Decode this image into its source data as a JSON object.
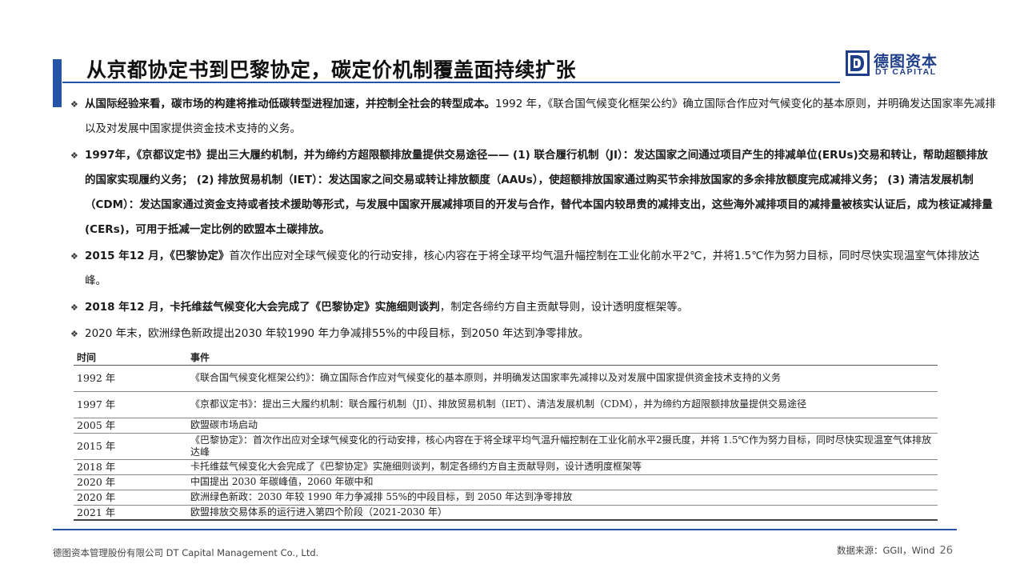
{
  "header": {
    "title": "从京都协定书到巴黎协定，碳定价机制覆盖面持续扩张"
  },
  "logo": {
    "cn": "德图资本",
    "en": "DT CAPITAL",
    "brand_color": "#1f3f8a",
    "icon": "dt-logo-mark"
  },
  "bullets": [
    {
      "bold": "从国际经验来看，碳市场的构建将推动低碳转型进程加速，并控制全社会的转型成本。",
      "text": "1992 年，《联合国气候变化框架公约》确立国际合作应对气候变化的基本原则，并明确发达国家率先减排以及对发展中国家提供资金技术支持的义务。"
    },
    {
      "bold": "1997年，《京都议定书》提出三大履约机制，并为缔约方超限额排放量提供交易途径—— (1) 联合履行机制（JI）：发达国家之间通过项目产生的排减单位(ERUs)交易和转让，帮助超额排放的国家实现履约义务； (2) 排放贸易机制（IET）：发达国家之间交易或转让排放额度（AAUs），使超额排放国家通过购买节余排放国家的多余排放额度完成减排义务； (3) 清洁发展机制（CDM）：发达国家通过资金支持或者技术援助等形式，与发展中国家开展减排项目的开发与合作，替代本国内较昂贵的减排支出，这些海外减排项目的减排量被核实认证后，成为核证减排量(CERs)，可用于抵减一定比例的欧盟本土碳排放。",
      "text": ""
    },
    {
      "bold": "2015 年12 月，《巴黎协定》",
      "text": "首次作出应对全球气候变化的行动安排，核心内容在于将全球平均气温升幅控制在工业化前水平2℃，并将1.5℃作为努力目标，同时尽快实现温室气体排放达峰。"
    },
    {
      "bold": "2018 年12 月，卡托维兹气候变化大会完成了《巴黎协定》实施细则谈判",
      "text": "，制定各缔约方自主贡献导则，设计透明度框架等。"
    },
    {
      "bold": "",
      "text": "2020 年末，欧洲绿色新政提出2030 年较1990 年力争减排55%的中段目标，到2050 年达到净零排放。"
    }
  ],
  "table": {
    "headers": [
      "时间",
      "事件"
    ],
    "rows": [
      {
        "year": "1992 年",
        "event": "《联合国气候变化框架公约》：确立国际合作应对气候变化的基本原则，并明确发达国家率先减排以及对发展中国家提供资金技术支持的义务",
        "lines": 2
      },
      {
        "year": "1997 年",
        "event": "《京都议定书》：提出三大履约机制：联合履行机制（JI）、排放贸易机制（IET）、清洁发展机制（CDM），并为缔约方超限额排放量提供交易途径",
        "lines": 2
      },
      {
        "year": "2005 年",
        "event": "欧盟碳市场启动",
        "lines": 1
      },
      {
        "year": "2015 年",
        "event": "《巴黎协定》：首次作出应对全球气候变化的行动安排，核心内容在于将全球平均气温升幅控制在工业化前水平2摄氏度，并将 1.5℃作为努力目标，同时尽快实现温室气体排放达峰",
        "lines": 2
      },
      {
        "year": "2018 年",
        "event": "卡托维兹气候变化大会完成了《巴黎协定》实施细则谈判，制定各缔约方自主贡献导则，设计透明度框架等",
        "lines": 1
      },
      {
        "year": "2020 年",
        "event": "中国提出 2030 年碳峰值，2060 年碳中和",
        "lines": 1
      },
      {
        "year": "2020 年",
        "event": "欧洲绿色新政：2030 年较 1990 年力争减排 55%的中段目标，到 2050 年达到净零排放",
        "lines": 1
      },
      {
        "year": "2021 年",
        "event": "欧盟排放交易体系的运行进入第四个阶段（2021-2030 年）",
        "lines": 1
      }
    ]
  },
  "footer": {
    "company": "德图资本管理股份有限公司  DT Capital Management  Co., Ltd.",
    "source": "数据来源：GGII，Wind",
    "page": "26"
  },
  "colors": {
    "accent": "#2454a6"
  }
}
